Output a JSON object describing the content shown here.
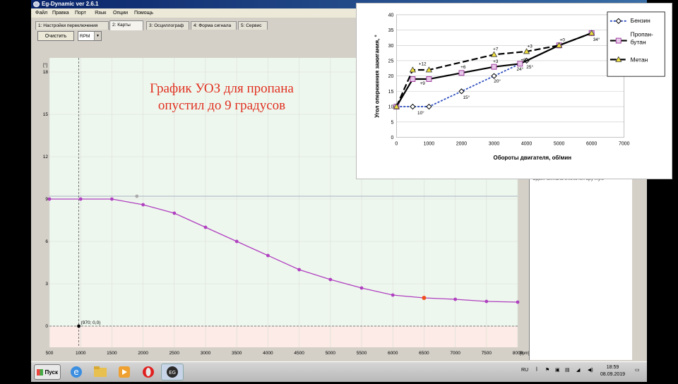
{
  "window": {
    "title": "Eg-Dynamic ver 2.6.1"
  },
  "menu": [
    "Файл",
    "Правка",
    "Порт",
    "Язык",
    "Опции",
    "Помощь"
  ],
  "tabs": [
    {
      "label": "1: Настройки переключения",
      "active": false
    },
    {
      "label": "2: Карты",
      "active": true
    },
    {
      "label": "3: Осциллограф",
      "active": false
    },
    {
      "label": "4: Форма сигнала",
      "active": false
    },
    {
      "label": "5: Сервис",
      "active": false
    }
  ],
  "toolbar": {
    "clear_label": "Очистить",
    "select_value": "RPM"
  },
  "annotation": {
    "line1": "График УОЗ для пропана",
    "line2": "опустил до 9 градусов",
    "color": "#e03020"
  },
  "chart_data": {
    "type": "line",
    "y_unit": "[°]",
    "x_unit": "[rpm]",
    "xlim": [
      500,
      8000
    ],
    "ylim": [
      -1.5,
      19
    ],
    "x_ticks": [
      500,
      1000,
      1500,
      2000,
      2500,
      3000,
      3500,
      4000,
      4500,
      5000,
      5500,
      6000,
      6500,
      7000,
      7500,
      8000
    ],
    "y_ticks": [
      0,
      3,
      6,
      9,
      12,
      15,
      18
    ],
    "series": [
      {
        "color": "#b040c0",
        "x": [
          500,
          1000,
          1500,
          2000,
          2500,
          3000,
          3500,
          4000,
          4500,
          5000,
          5500,
          6000,
          6500,
          7000,
          7500,
          8000
        ],
        "values": [
          9,
          9,
          9,
          8.6,
          8,
          7,
          6,
          5,
          4,
          3.3,
          2.7,
          2.2,
          2.0,
          1.9,
          1.75,
          1.7
        ],
        "highlight_x": 6500
      }
    ],
    "reference_y": 9.2,
    "gray_point": [
      1900,
      9.2
    ],
    "cursor": {
      "x": 970,
      "y": 0,
      "label": "(970; 0,0)"
    }
  },
  "inset": {
    "ylabel": "Угол опережения зажигания, °",
    "xlabel": "Обороты двигателя, об/мин",
    "legend": [
      "Бензин",
      "Пропан-бутан",
      "Метан"
    ],
    "chart_data": {
      "type": "line",
      "x_ticks": [
        0,
        1000,
        2000,
        3000,
        4000,
        5000,
        6000,
        7000
      ],
      "y_ticks": [
        0,
        5,
        10,
        15,
        20,
        25,
        30,
        35,
        40
      ],
      "xlim": [
        0,
        7000
      ],
      "ylim": [
        0,
        40
      ],
      "series": [
        {
          "name": "Бензин",
          "color": "#3050c0",
          "x": [
            0,
            500,
            1000,
            2000,
            3000,
            4000,
            5000,
            6000
          ],
          "values": [
            10,
            10,
            10,
            15,
            20,
            25,
            30,
            34
          ]
        },
        {
          "name": "Пропан-бутан",
          "color": "#000000",
          "x": [
            0,
            500,
            1000,
            2000,
            3000,
            3800,
            5000,
            6000
          ],
          "values": [
            10,
            19,
            19,
            21,
            23,
            24,
            30,
            34
          ]
        },
        {
          "name": "Метан",
          "color": "#000000",
          "x": [
            0,
            500,
            1000,
            3000,
            4000,
            5000,
            6000
          ],
          "values": [
            10,
            22,
            22,
            27,
            28,
            30,
            34
          ]
        }
      ],
      "labels": [
        {
          "text": "10°",
          "x": 750,
          "y": 7.5
        },
        {
          "text": "15°",
          "x": 2150,
          "y": 12.5
        },
        {
          "text": "20°",
          "x": 3100,
          "y": 17.8
        },
        {
          "text": "25°",
          "x": 4100,
          "y": 22.5
        },
        {
          "text": "24°",
          "x": 3800,
          "y": 21.8
        },
        {
          "text": "34°",
          "x": 6150,
          "y": 31.5
        },
        {
          "text": "+12",
          "x": 800,
          "y": 23.5
        },
        {
          "text": "+9",
          "x": 800,
          "y": 17.2
        },
        {
          "text": "+6",
          "x": 2050,
          "y": 22.5
        },
        {
          "text": "+7",
          "x": 3050,
          "y": 28.3
        },
        {
          "text": "+3",
          "x": 3050,
          "y": 24.3
        },
        {
          "text": "+3",
          "x": 4100,
          "y": 29.3
        },
        {
          "text": "+0",
          "x": 5100,
          "y": 31.3
        },
        {
          "text": "+0",
          "x": 3900,
          "y": 24.8
        }
      ]
    }
  },
  "log_text": "Сдвиг сигнала отключен вручную",
  "taskbar": {
    "start": "Пуск",
    "lang": "RU",
    "time": "18:59",
    "date": "08.09.2019"
  }
}
